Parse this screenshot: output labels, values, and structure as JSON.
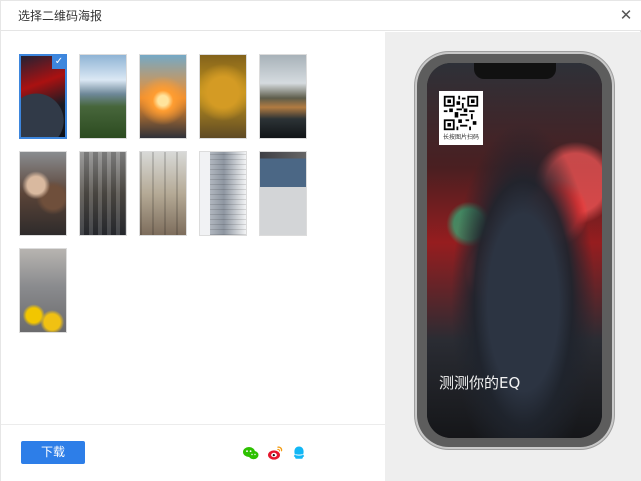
{
  "dialog": {
    "title": "选择二维码海报",
    "close_icon": "close-icon"
  },
  "thumbnails": [
    {
      "name": "umbrella-city",
      "selected": true
    },
    {
      "name": "mountain-valley",
      "selected": false
    },
    {
      "name": "sunset-clouds",
      "selected": false
    },
    {
      "name": "autumn-tree",
      "selected": false
    },
    {
      "name": "lake-forest",
      "selected": false
    },
    {
      "name": "people-laughing",
      "selected": false
    },
    {
      "name": "cafe-interior",
      "selected": false
    },
    {
      "name": "restaurant-hall",
      "selected": false
    },
    {
      "name": "skyscraper",
      "selected": false
    },
    {
      "name": "desk-monitor",
      "selected": false
    },
    {
      "name": "city-traffic",
      "selected": false
    }
  ],
  "footer": {
    "download_label": "下载",
    "share_icons": [
      "wechat-icon",
      "weibo-icon",
      "qq-icon"
    ]
  },
  "preview": {
    "qr_label": "长按图片扫码",
    "poster_title": "测测你的EQ"
  },
  "colors": {
    "accent": "#2d7ee8",
    "selected_border": "#3d86dd",
    "wechat": "#2dc100",
    "weibo": "#e6162d",
    "qq": "#12b7f5"
  }
}
